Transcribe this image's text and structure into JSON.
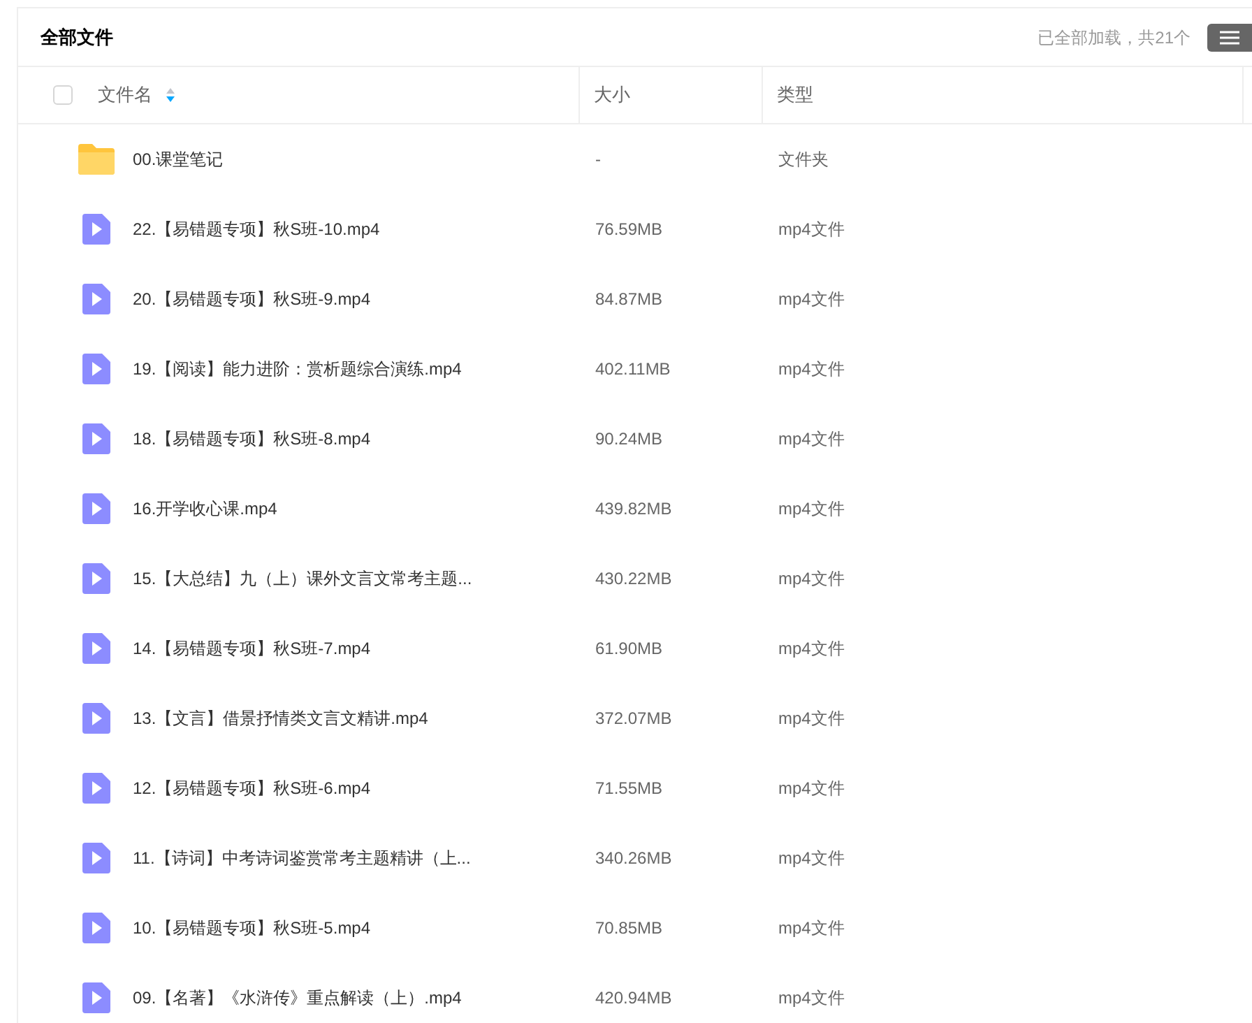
{
  "header": {
    "title": "全部文件",
    "status": "已全部加载，共21个"
  },
  "table": {
    "columns": [
      "文件名",
      "大小",
      "类型"
    ],
    "select_all": {
      "checked": false
    },
    "rows": [
      {
        "kind": "folder",
        "name": "00.课堂笔记",
        "size": "-",
        "type": "文件夹"
      },
      {
        "kind": "video",
        "name": "22.【易错题专项】秋S班-10.mp4",
        "size": "76.59MB",
        "type": "mp4文件"
      },
      {
        "kind": "video",
        "name": "20.【易错题专项】秋S班-9.mp4",
        "size": "84.87MB",
        "type": "mp4文件"
      },
      {
        "kind": "video",
        "name": "19.【阅读】能力进阶：赏析题综合演练.mp4",
        "size": "402.11MB",
        "type": "mp4文件"
      },
      {
        "kind": "video",
        "name": "18.【易错题专项】秋S班-8.mp4",
        "size": "90.24MB",
        "type": "mp4文件"
      },
      {
        "kind": "video",
        "name": "16.开学收心课.mp4",
        "size": "439.82MB",
        "type": "mp4文件"
      },
      {
        "kind": "video",
        "name": "15.【大总结】九（上）课外文言文常考主题...",
        "size": "430.22MB",
        "type": "mp4文件"
      },
      {
        "kind": "video",
        "name": "14.【易错题专项】秋S班-7.mp4",
        "size": "61.90MB",
        "type": "mp4文件"
      },
      {
        "kind": "video",
        "name": "13.【文言】借景抒情类文言文精讲.mp4",
        "size": "372.07MB",
        "type": "mp4文件"
      },
      {
        "kind": "video",
        "name": "12.【易错题专项】秋S班-6.mp4",
        "size": "71.55MB",
        "type": "mp4文件"
      },
      {
        "kind": "video",
        "name": "11.【诗词】中考诗词鉴赏常考主题精讲（上...",
        "size": "340.26MB",
        "type": "mp4文件"
      },
      {
        "kind": "video",
        "name": "10.【易错题专项】秋S班-5.mp4",
        "size": "70.85MB",
        "type": "mp4文件"
      },
      {
        "kind": "video",
        "name": "09.【名著】《水浒传》重点解读（上）.mp4",
        "size": "420.94MB",
        "type": "mp4文件"
      }
    ]
  }
}
